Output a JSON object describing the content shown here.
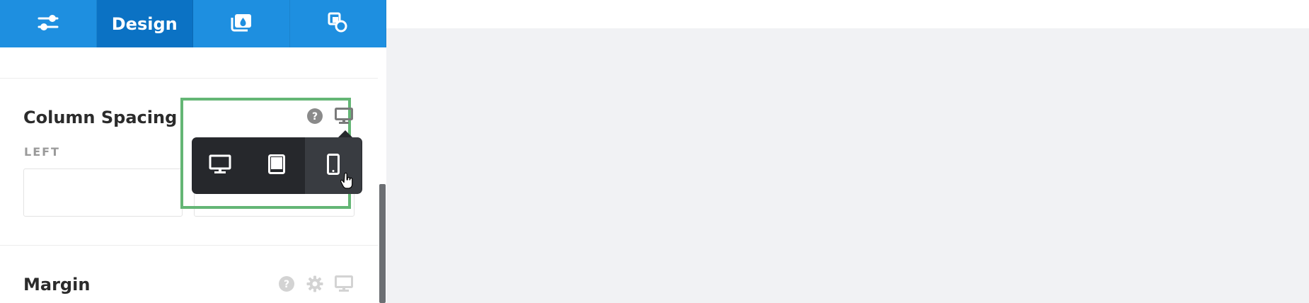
{
  "tabs": [
    {
      "name": "general",
      "icon": "sliders-icon",
      "label": ""
    },
    {
      "name": "design",
      "icon": "",
      "label": "Design"
    },
    {
      "name": "layers",
      "icon": "photo-stack-icon",
      "label": ""
    },
    {
      "name": "shapes",
      "icon": "shapes-icon",
      "label": ""
    }
  ],
  "sections": {
    "column_spacing": {
      "title": "Column Spacing",
      "left_label": "LEFT",
      "left_value": "",
      "right_value": ""
    },
    "margin": {
      "title": "Margin"
    }
  },
  "responsive_popup": {
    "options": [
      "desktop",
      "tablet",
      "mobile"
    ],
    "active": "mobile"
  },
  "colors": {
    "accent": "#1e8fe0",
    "accent_active": "#0b72c4",
    "highlight": "#64b675",
    "popup_bg": "#26282c"
  }
}
